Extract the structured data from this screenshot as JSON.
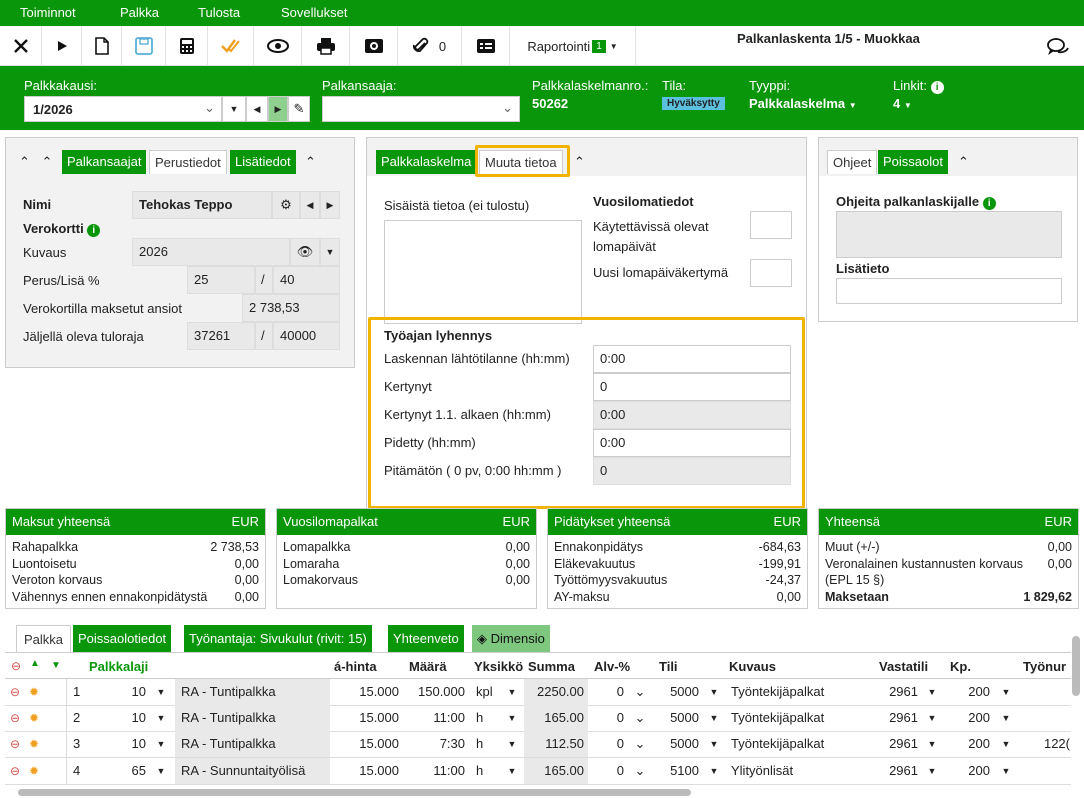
{
  "menu": [
    "Toiminnot",
    "Palkka",
    "Tulosta",
    "Sovellukset"
  ],
  "toolbar": {
    "attachments": "0",
    "report": "Raportointi",
    "report_badge": "1",
    "title": "Palkanlaskenta 1/5 - Muokkaa"
  },
  "header": {
    "period_label": "Palkkakausi:",
    "period_value": "1/2026",
    "earner_label": "Palkansaaja:",
    "calcno_label": "Palkkalaskelmanro.:",
    "calcno": "50262",
    "state_label": "Tila:",
    "state": "Hyväksytty",
    "type_label": "Tyyppi:",
    "type": "Palkkalaskelma",
    "links_label": "Linkit:",
    "links": "4"
  },
  "left": {
    "tabs": [
      "Palkansaajat",
      "Perustiedot",
      "Lisätiedot"
    ],
    "name_label": "Nimi",
    "name": "Tehokas Teppo",
    "tax_label": "Verokortti",
    "desc_label": "Kuvaus",
    "desc": "2026",
    "rate_label": "Perus/Lisä %",
    "rate1": "25",
    "rate2": "40",
    "paid_label": "Verokortilla maksetut ansiot",
    "paid": "2 738,53",
    "remain_label": "Jäljellä oleva tuloraja",
    "remain1": "37261",
    "remain2": "40000",
    "slash": "/"
  },
  "mid": {
    "tabs": [
      "Palkkalaskelma",
      "Muuta tietoa"
    ],
    "internal_label": "Sisäistä tietoa (ei tulostu)",
    "vac_title": "Vuosilomatiedot",
    "vac_avail": "Käytettävissä olevat lomapäivät",
    "vac_new": "Uusi lomapäiväkertymä",
    "short_title": "Työajan lyhennys",
    "rows": [
      {
        "label": "Laskennan lähtötilanne (hh:mm)",
        "value": "0:00"
      },
      {
        "label": "Kertynyt",
        "value": "0"
      },
      {
        "label": "Kertynyt 1.1. alkaen (hh:mm)",
        "value": "0:00"
      },
      {
        "label": "Pidetty (hh:mm)",
        "value": "0:00"
      },
      {
        "label": "Pitämätön ( 0 pv, 0:00 hh:mm )",
        "value": "0"
      }
    ]
  },
  "right": {
    "tabs": [
      "Ohjeet",
      "Poissaolot"
    ],
    "guide_label": "Ohjeita palkanlaskijalle",
    "extra_label": "Lisätieto"
  },
  "sums": [
    {
      "title": "Maksut yhteensä",
      "cur": "EUR",
      "rows": [
        [
          "Rahapalkka",
          "2 738,53"
        ],
        [
          "Luontoisetu",
          "0,00"
        ],
        [
          "Veroton korvaus",
          "0,00"
        ],
        [
          "Vähennys ennen ennakonpidätystä",
          "0,00"
        ]
      ]
    },
    {
      "title": "Vuosilomapalkat",
      "cur": "EUR",
      "rows": [
        [
          "Lomapalkka",
          "0,00"
        ],
        [
          "Lomaraha",
          "0,00"
        ],
        [
          "Lomakorvaus",
          "0,00"
        ]
      ]
    },
    {
      "title": "Pidätykset yhteensä",
      "cur": "EUR",
      "rows": [
        [
          "Ennakonpidätys",
          "-684,63"
        ],
        [
          "Eläkevakuutus",
          "-199,91"
        ],
        [
          "Työttömyysvakuutus",
          "-24,37"
        ],
        [
          "AY-maksu",
          "0,00"
        ]
      ]
    },
    {
      "title": "Yhteensä",
      "cur": "EUR",
      "rows": [
        [
          "Muut (+/-)",
          "0,00"
        ],
        [
          "Veronalainen kustannusten korvaus",
          "0,00"
        ],
        [
          "(EPL 15 §)",
          ""
        ],
        [
          "Maksetaan",
          "1 829,62"
        ]
      ]
    }
  ],
  "bottom_tabs": [
    "Palkka",
    "Poissaolotiedot",
    "Työnantaja: Sivukulut (rivit: 15)",
    "Yhteenveto",
    "Dimensio"
  ],
  "grid": {
    "headers": [
      "Palkkalaji",
      "á-hinta",
      "Määrä",
      "Yksikkö",
      "Summa",
      "Alv-%",
      "Tili",
      "Kuvaus",
      "Vastatili",
      "Kp.",
      "Työnur"
    ],
    "rows": [
      [
        "1",
        "10",
        "RA - Tuntipalkka",
        "15.000",
        "150.000",
        "kpl",
        "2250.00",
        "0",
        "5000",
        "Työntekijäpalkat",
        "2961",
        "200",
        ""
      ],
      [
        "2",
        "10",
        "RA - Tuntipalkka",
        "15.000",
        "11:00",
        "h",
        "165.00",
        "0",
        "5000",
        "Työntekijäpalkat",
        "2961",
        "200",
        ""
      ],
      [
        "3",
        "10",
        "RA - Tuntipalkka",
        "15.000",
        "7:30",
        "h",
        "112.50",
        "0",
        "5000",
        "Työntekijäpalkat",
        "2961",
        "200",
        "122("
      ],
      [
        "4",
        "65",
        "RA - Sunnuntaityölisä",
        "15.000",
        "11:00",
        "h",
        "165.00",
        "0",
        "5100",
        "Ylityönlisät",
        "2961",
        "200",
        ""
      ]
    ]
  },
  "colors": {
    "green": "#0a960a",
    "highlight": "#f0b400",
    "badge": "#5bc0de"
  }
}
